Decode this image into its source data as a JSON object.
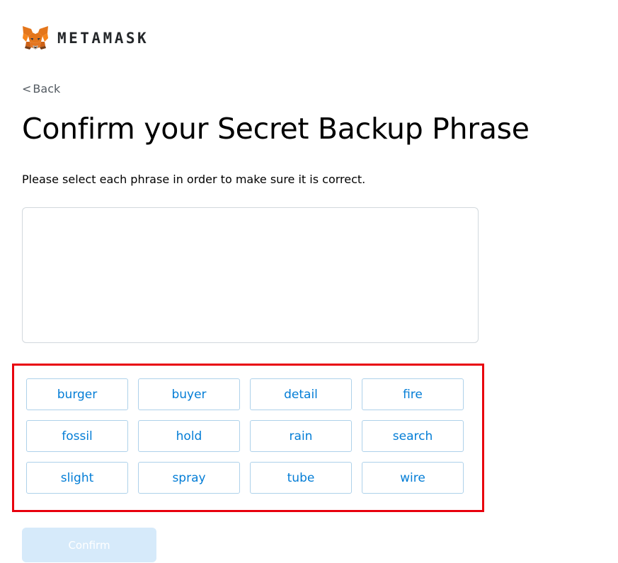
{
  "header": {
    "logo_icon": "metamask-fox-icon",
    "brand": "METAMASK"
  },
  "nav": {
    "back_chevron": "<",
    "back_label": "Back"
  },
  "main": {
    "title": "Confirm your Secret Backup Phrase",
    "instruction": "Please select each phrase in order to make sure it is correct.",
    "selected_words": [],
    "words": [
      "burger",
      "buyer",
      "detail",
      "fire",
      "fossil",
      "hold",
      "rain",
      "search",
      "slight",
      "spray",
      "tube",
      "wire"
    ]
  },
  "actions": {
    "confirm_label": "Confirm",
    "confirm_disabled": true
  },
  "colors": {
    "accent": "#037dd6",
    "word_border": "#aed1ea",
    "highlight": "#e8000d",
    "confirm_disabled_bg": "#d6eafa",
    "fox_orange": "#e2761b",
    "fox_dark": "#763d16"
  }
}
